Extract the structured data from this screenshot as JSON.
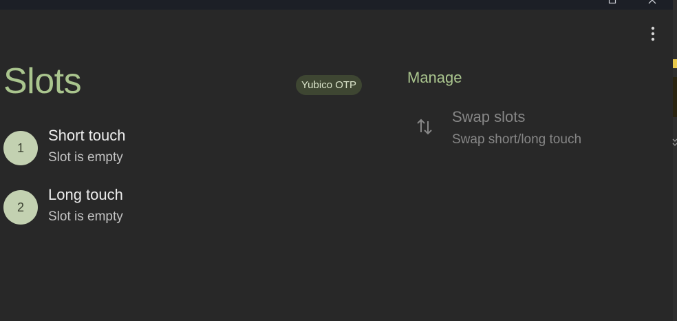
{
  "window": {
    "controls": [
      "restore-icon",
      "close-icon"
    ]
  },
  "header": {
    "menu_icon": "more-vert-icon"
  },
  "page": {
    "title": "Slots",
    "chip_label": "Yubico OTP"
  },
  "slots": [
    {
      "number": "1",
      "title": "Short touch",
      "subtitle": "Slot is empty"
    },
    {
      "number": "2",
      "title": "Long touch",
      "subtitle": "Slot is empty"
    }
  ],
  "manage": {
    "heading": "Manage",
    "actions": [
      {
        "icon": "swap-vert-icon",
        "title": "Swap slots",
        "subtitle": "Swap short/long touch"
      }
    ]
  },
  "colors": {
    "background": "#282828",
    "accent": "#aac58e",
    "avatar": "#c3d1b1",
    "chip_bg": "#3e4632",
    "disabled_text": "#878787"
  }
}
